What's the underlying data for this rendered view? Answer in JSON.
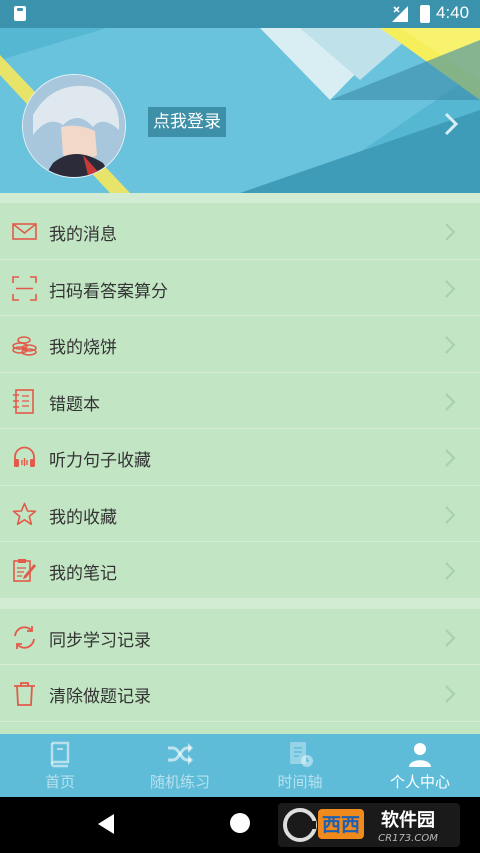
{
  "status_bar": {
    "time": "4:40"
  },
  "header": {
    "login_label": "点我登录"
  },
  "menu": {
    "group1": [
      {
        "label": "我的消息",
        "icon": "envelope-icon"
      },
      {
        "label": "扫码看答案算分",
        "icon": "scan-icon"
      },
      {
        "label": "我的烧饼",
        "icon": "coins-icon"
      },
      {
        "label": "错题本",
        "icon": "notebook-icon"
      },
      {
        "label": "听力句子收藏",
        "icon": "headphones-icon"
      },
      {
        "label": "我的收藏",
        "icon": "star-icon"
      },
      {
        "label": "我的笔记",
        "icon": "note-edit-icon"
      }
    ],
    "group2": [
      {
        "label": "同步学习记录",
        "icon": "sync-icon"
      },
      {
        "label": "清除做题记录",
        "icon": "trash-icon"
      }
    ]
  },
  "bottom_nav": {
    "tabs": [
      {
        "label": "首页",
        "icon": "book-icon",
        "active": false
      },
      {
        "label": "随机练习",
        "icon": "shuffle-icon",
        "active": false
      },
      {
        "label": "时间轴",
        "icon": "timeline-icon",
        "active": false
      },
      {
        "label": "个人中心",
        "icon": "person-icon",
        "active": true
      }
    ]
  },
  "colors": {
    "accent": "#e35a4a",
    "header": "#4fb4cf",
    "menu_bg": "#c2e5c4",
    "nav_bg": "#5fbcd9"
  },
  "watermark": {
    "brand": "西西软件园",
    "domain": "CR173.COM"
  }
}
